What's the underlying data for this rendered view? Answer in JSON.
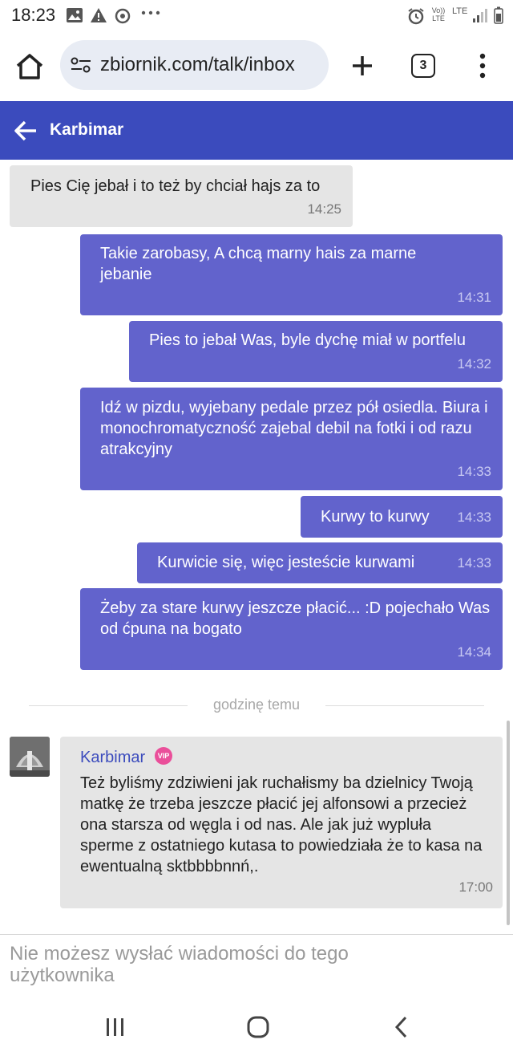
{
  "status_bar": {
    "time": "18:23",
    "volte": "Vo)) LTE",
    "lte": "LTE"
  },
  "browser": {
    "url": "zbiornik.com/talk/inbox",
    "tab_count": "3"
  },
  "chat": {
    "title": "Karbimar"
  },
  "messages": [
    {
      "direction": "in",
      "text": "Pies Cię jebał i to też by chciał hajs za to",
      "time": "14:25"
    },
    {
      "direction": "out",
      "text": "Takie zarobasy, A chcą marny hais za marne jebanie",
      "time": "14:31"
    },
    {
      "direction": "out",
      "text": "Pies to jebał Was, byle dychę miał w portfelu",
      "time": "14:32"
    },
    {
      "direction": "out",
      "text": "Idź w pizdu, wyjebany pedale przez pół osiedla. Biura i monochromatyczność zajebal debil na fotki i od razu atrakcyjny",
      "time": "14:33"
    },
    {
      "direction": "out",
      "text": "Kurwy to kurwy",
      "time": "14:33"
    },
    {
      "direction": "out",
      "text": "Kurwicie się, więc jesteście kurwami",
      "time": "14:33"
    },
    {
      "direction": "out",
      "text": "Żeby za stare kurwy jeszcze płacić... :D pojechało Was od ćpuna na bogato",
      "time": "14:34"
    }
  ],
  "divider_label": "godzinę temu",
  "incoming_card": {
    "name": "Karbimar",
    "badge": "VIP",
    "text": "Też byliśmy zdziwieni jak ruchałismy ba dzielnicy Twoją matkę że trzeba jeszcze płacić jej alfonsowi a przecież ona starsza od węgla i od nas. Ale jak już wypluła sperme z ostatniego kutasa to powiedziała że to kasa na ewentualną sktbbbbnnń,.",
    "time": "17:00"
  },
  "composer_notice": "Nie możesz wysłać wiadomości do tego użytkownika",
  "colors": {
    "header": "#3b4bbd",
    "outgoing_bubble": "#6263cc",
    "incoming_bubble": "#e5e5e5",
    "vip_badge": "#ea4f9a"
  },
  "icons": [
    "image-icon",
    "warning-icon",
    "sync-icon",
    "more-dots-icon",
    "alarm-icon",
    "signal-icon",
    "home-icon",
    "site-settings-icon",
    "plus-icon",
    "tabs-icon",
    "menu-icon",
    "back-arrow-icon",
    "recents-icon",
    "home-circle-icon",
    "back-chevron-icon"
  ]
}
